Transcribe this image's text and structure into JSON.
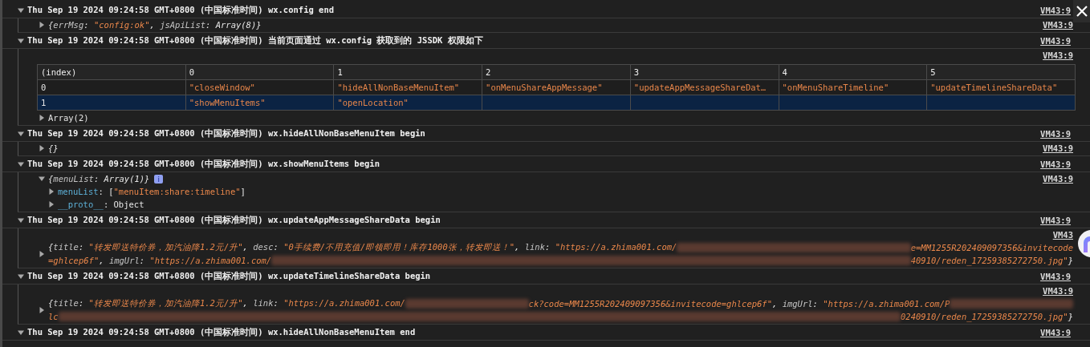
{
  "entries": [
    {
      "expanded": true,
      "message": "Thu Sep 19 2024 09:24:58 GMT+0800 (中国标准时间) wx.config end",
      "source": "VM43:9",
      "body": [
        {
          "kind": "object",
          "expanded": false,
          "source": "VM43:9",
          "lines": [
            [
              {
                "kind": "preview",
                "text": "{"
              },
              {
                "kind": "preview_key",
                "text": "errMsg"
              },
              {
                "kind": "preview",
                "text": ": "
              },
              {
                "kind": "preview_string",
                "text": "\"config:ok\""
              },
              {
                "kind": "preview",
                "text": ", "
              },
              {
                "kind": "preview_key",
                "text": "jsApiList"
              },
              {
                "kind": "preview",
                "text": ": Array(8)}"
              }
            ]
          ]
        }
      ]
    },
    {
      "expanded": true,
      "message": "Thu Sep 19 2024 09:24:58 GMT+0800 (中国标准时间) 当前页面通过 wx.config 获取到的 JSSDK 权限如下",
      "source": "VM43:9",
      "body": [
        {
          "kind": "source",
          "source": "VM43:9"
        },
        {
          "kind": "table",
          "columns": [
            "(index)",
            "0",
            "1",
            "2",
            "3",
            "4",
            "5"
          ],
          "rows": [
            {
              "selected": false,
              "cells": [
                "0",
                "\"closeWindow\"",
                "\"hideAllNonBaseMenuItem\"",
                "\"onMenuShareAppMessage\"",
                "\"updateAppMessageShareDat…",
                "\"onMenuShareTimeline\"",
                "\"updateTimelineShareData\""
              ]
            },
            {
              "selected": true,
              "cells": [
                "1",
                "\"showMenuItems\"",
                "\"openLocation\"",
                "",
                "",
                "",
                ""
              ]
            }
          ]
        },
        {
          "kind": "object",
          "expanded": false,
          "lines": [
            [
              {
                "kind": "plain",
                "text": "Array(2)"
              }
            ]
          ]
        }
      ]
    },
    {
      "expanded": true,
      "message": "Thu Sep 19 2024 09:24:58 GMT+0800 (中国标准时间) wx.hideAllNonBaseMenuItem begin",
      "source": "VM43:9",
      "body": [
        {
          "kind": "object",
          "expanded": false,
          "source": "VM43:9",
          "lines": [
            [
              {
                "kind": "preview",
                "text": "{}"
              }
            ]
          ]
        }
      ]
    },
    {
      "expanded": true,
      "message": "Thu Sep 19 2024 09:24:58 GMT+0800 (中国标准时间) wx.showMenuItems begin",
      "source": "VM43:9",
      "body": [
        {
          "kind": "object",
          "expanded": true,
          "info_badge": true,
          "source": "VM43:9",
          "lines": [
            [
              {
                "kind": "preview",
                "text": "{"
              },
              {
                "kind": "preview_key",
                "text": "menuList"
              },
              {
                "kind": "preview",
                "text": ": Array(1)}"
              }
            ]
          ],
          "children": [
            {
              "expanded": false,
              "segments": [
                {
                  "kind": "prop",
                  "text": "menuList"
                },
                {
                  "kind": "plain",
                  "text": ": ["
                },
                {
                  "kind": "string",
                  "text": "\"menuItem:share:timeline\""
                },
                {
                  "kind": "plain",
                  "text": "]"
                }
              ]
            },
            {
              "expanded": false,
              "segments": [
                {
                  "kind": "prop",
                  "text": "__proto__"
                },
                {
                  "kind": "plain",
                  "text": ": Object"
                }
              ]
            }
          ]
        }
      ]
    },
    {
      "expanded": true,
      "message": "Thu Sep 19 2024 09:24:58 GMT+0800 (中国标准时间) wx.updateAppMessageShareData begin",
      "source": "VM43:9",
      "body": [
        {
          "kind": "source",
          "source": "VM43"
        },
        {
          "kind": "object",
          "expanded": false,
          "lines": [
            [
              {
                "kind": "preview",
                "text": "{"
              },
              {
                "kind": "preview_key",
                "text": "title"
              },
              {
                "kind": "preview",
                "text": ": "
              },
              {
                "kind": "preview_string",
                "text": "\"转发即送特价券，加汽油降1.2元/升\""
              },
              {
                "kind": "preview",
                "text": ", "
              },
              {
                "kind": "preview_key",
                "text": "desc"
              },
              {
                "kind": "preview",
                "text": ": "
              },
              {
                "kind": "preview_string",
                "text": "\"0手续费/不用充值/即领即用！库存1000张，转发即送！\""
              },
              {
                "kind": "preview",
                "text": ", "
              },
              {
                "kind": "preview_key",
                "text": "link"
              },
              {
                "kind": "preview",
                "text": ": "
              },
              {
                "kind": "preview_string",
                "text": "\"https://a.zhima001.com/"
              },
              {
                "kind": "redaction"
              },
              {
                "kind": "preview_string",
                "text": "e=MM1255R202409097356&invitecode"
              }
            ],
            [
              {
                "kind": "preview_string",
                "text": "=ghlcep6f\""
              },
              {
                "kind": "preview",
                "text": ", "
              },
              {
                "kind": "preview_key",
                "text": "imgUrl"
              },
              {
                "kind": "preview",
                "text": ": "
              },
              {
                "kind": "preview_string",
                "text": "\"https://a.zhima001.com/"
              },
              {
                "kind": "redaction"
              },
              {
                "kind": "preview_string",
                "text": "40910/reden_17259385272750.jpg\""
              },
              {
                "kind": "preview",
                "text": "}"
              }
            ]
          ]
        }
      ]
    },
    {
      "expanded": true,
      "message": "Thu Sep 19 2024 09:24:58 GMT+0800 (中国标准时间) wx.updateTimelineShareData begin",
      "source": "VM43:9",
      "body": [
        {
          "kind": "source",
          "source": "VM43:9"
        },
        {
          "kind": "object",
          "expanded": false,
          "lines": [
            [
              {
                "kind": "preview",
                "text": "{"
              },
              {
                "kind": "preview_key",
                "text": "title"
              },
              {
                "kind": "preview",
                "text": ": "
              },
              {
                "kind": "preview_string",
                "text": "\"转发即送特价券，加汽油降1.2元/升\""
              },
              {
                "kind": "preview",
                "text": ", "
              },
              {
                "kind": "preview_key",
                "text": "link"
              },
              {
                "kind": "preview",
                "text": ": "
              },
              {
                "kind": "preview_string",
                "text": "\"https://a.zhima001.com/"
              },
              {
                "kind": "redaction"
              },
              {
                "kind": "preview_string",
                "text": "ck?code=MM1255R202409097356&invitecode=ghlcep6f\""
              },
              {
                "kind": "preview",
                "text": ", "
              },
              {
                "kind": "preview_key",
                "text": "imgUrl"
              },
              {
                "kind": "preview",
                "text": ": "
              },
              {
                "kind": "preview_string",
                "text": "\"https://a.zhima001.com/P"
              },
              {
                "kind": "redaction"
              }
            ],
            [
              {
                "kind": "preview_string",
                "text": "lc"
              },
              {
                "kind": "redaction"
              },
              {
                "kind": "preview_string",
                "text": "0240910/reden_17259385272750.jpg\""
              },
              {
                "kind": "preview",
                "text": "}"
              }
            ]
          ]
        }
      ]
    },
    {
      "expanded": true,
      "message": "Thu Sep 19 2024 09:24:58 GMT+0800 (中国标准时间) wx.hideAllNonBaseMenuItem end",
      "source": "VM43:9"
    }
  ]
}
